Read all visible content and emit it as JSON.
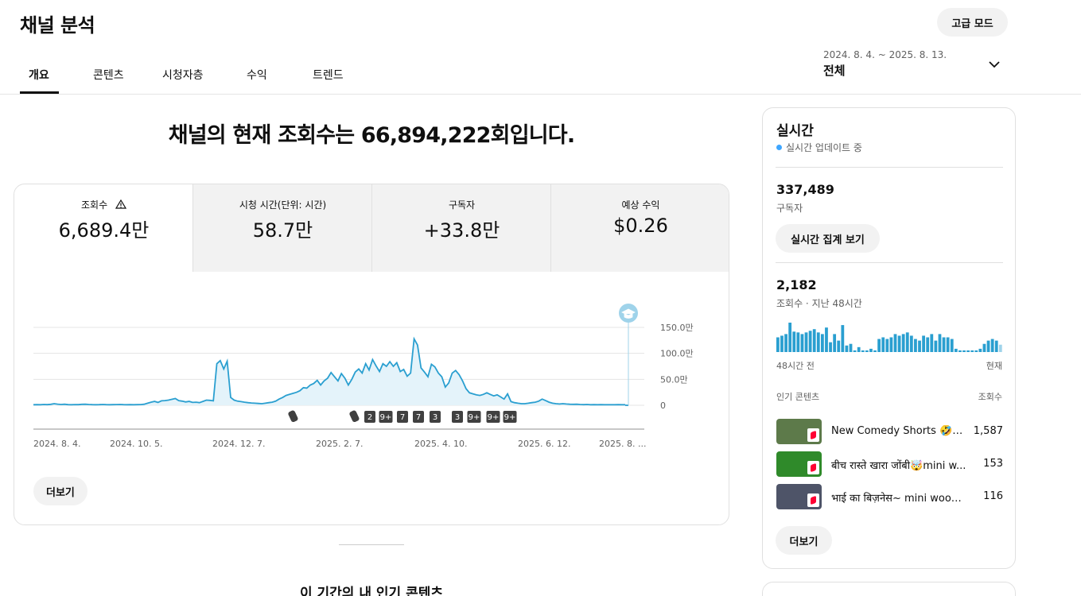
{
  "header": {
    "title": "채널 분석",
    "advanced_mode": "고급 모드",
    "tabs": [
      {
        "label": "개요",
        "active": true
      },
      {
        "label": "콘텐츠",
        "active": false
      },
      {
        "label": "시청자층",
        "active": false
      },
      {
        "label": "수익",
        "active": false
      },
      {
        "label": "트렌드",
        "active": false
      }
    ],
    "date_range": {
      "text": "2024. 8. 4. ~ 2025. 8. 13.",
      "value": "전체",
      "icon": "chevron-down-icon"
    }
  },
  "main": {
    "headline": "채널의 현재 조회수는 66,894,222회입니다.",
    "metrics": [
      {
        "label": "조회수",
        "value": "6,689.4만",
        "active": true,
        "icon": "warning-icon"
      },
      {
        "label": "시청 시간(단위: 시간)",
        "value": "58.7만",
        "active": false
      },
      {
        "label": "구독자",
        "value": "+33.8만",
        "active": false
      },
      {
        "label": "예상 수익",
        "value": "$0.26",
        "active": false
      }
    ],
    "more_button": "더보기",
    "popular_heading": "이 기간의 내 인기 콘텐츠"
  },
  "chart_data": {
    "type": "area",
    "x_tick_labels": [
      "2024. 8. 4.",
      "2024. 10. 5.",
      "2024. 12. 7.",
      "2025. 2. 7.",
      "2025. 4. 10.",
      "2025. 6. 12.",
      "2025. 8. ..."
    ],
    "y_tick_labels": [
      "150.0만",
      "100.0만",
      "50.0만",
      "0"
    ],
    "ylim": [
      0,
      1500000
    ],
    "grid": true,
    "color": "#2a9fd0",
    "fill_color": "#e4f3fa",
    "series": [
      {
        "values": [
          10000,
          12000,
          10000,
          15000,
          12000,
          18000,
          30000,
          22000,
          15000,
          20000,
          12000,
          10000,
          14000,
          12000,
          18000,
          20000,
          15000,
          12000,
          10000,
          12000,
          15000,
          12000,
          10000,
          12000,
          14000,
          15000,
          12000,
          10000,
          12000,
          10000,
          12000,
          14000,
          20000,
          40000,
          60000,
          75000,
          55000,
          85000,
          90000,
          100000,
          115000,
          130000,
          90000,
          80000,
          65000,
          75000,
          55000,
          60000,
          50000,
          75000,
          100000,
          95000,
          85000,
          800000,
          860000,
          700000,
          850000,
          150000,
          100000,
          80000,
          70000,
          60000,
          50000,
          45000,
          40000,
          35000,
          30000,
          40000,
          50000,
          60000,
          80000,
          120000,
          150000,
          190000,
          210000,
          230000,
          250000,
          280000,
          340000,
          330000,
          390000,
          420000,
          480000,
          390000,
          470000,
          520000,
          630000,
          550000,
          470000,
          610000,
          520000,
          390000,
          500000,
          640000,
          700000,
          620000,
          800000,
          680000,
          880000,
          760000,
          650000,
          800000,
          750000,
          840000,
          750000,
          820000,
          650000,
          690000,
          560000,
          620000,
          1280000,
          1160000,
          720000,
          640000,
          550000,
          790000,
          740000,
          620000,
          550000,
          350000,
          430000,
          620000,
          670000,
          590000,
          470000,
          320000,
          240000,
          220000,
          200000,
          190000,
          210000,
          240000,
          210000,
          180000,
          200000,
          160000,
          120000,
          220000,
          70000,
          50000,
          40000,
          30000,
          30000,
          40000,
          50000,
          60000,
          80000,
          120000,
          90000,
          60000,
          40000,
          30000,
          25000,
          30000,
          25000,
          20000,
          18000,
          20000,
          15000,
          12000,
          15000,
          10000,
          12000,
          10000,
          12000,
          10000,
          10000,
          10000,
          10000,
          12000,
          10000,
          10000
        ]
      }
    ],
    "markers": [
      {
        "icon": "shorts-icon",
        "label": ""
      },
      {
        "icon": "shorts-icon",
        "label": ""
      },
      {
        "icon": "",
        "label": "2"
      },
      {
        "icon": "",
        "label": "9+"
      },
      {
        "icon": "",
        "label": "7"
      },
      {
        "icon": "",
        "label": "7"
      },
      {
        "icon": "",
        "label": "3"
      },
      {
        "icon": "",
        "label": "3"
      },
      {
        "icon": "",
        "label": "9+"
      },
      {
        "icon": "",
        "label": "9+"
      },
      {
        "icon": "",
        "label": "9+"
      }
    ],
    "milestone_icon": "graduation-cap-icon"
  },
  "realtime": {
    "title": "실시간",
    "live_label": "실시간 업데이트 중",
    "subscribers": {
      "value": "337,489",
      "label": "구독자"
    },
    "report_button": "실시간 집계 보기",
    "views": {
      "value": "2,182",
      "label": "조회수 · 지난 48시간"
    },
    "bar_values": [
      18,
      20,
      22,
      36,
      25,
      24,
      22,
      24,
      26,
      28,
      24,
      22,
      30,
      12,
      22,
      14,
      33,
      8,
      10,
      2,
      6,
      2,
      2,
      4,
      2,
      16,
      18,
      16,
      18,
      22,
      20,
      22,
      24,
      20,
      16,
      14,
      20,
      18,
      22,
      14,
      22,
      18,
      18,
      16,
      4,
      2,
      2,
      2,
      2,
      2,
      4,
      10,
      14,
      16,
      14,
      9
    ],
    "axis_left": "48시간 전",
    "axis_right": "현재",
    "list_header": {
      "left": "인기 콘텐츠",
      "right": "조회수"
    },
    "items": [
      {
        "title": "New Comedy Shorts 🤣~...",
        "count": "1,587",
        "thumb_color": "#5d7a4a"
      },
      {
        "title": "बीच रास्ते खारा जोंबी🤯mini w...",
        "count": "153",
        "thumb_color": "#2f8a2a"
      },
      {
        "title": "भाई का बिज़नेस~ mini wood ...",
        "count": "116",
        "thumb_color": "#4e5468"
      }
    ],
    "more_button": "더보기"
  }
}
